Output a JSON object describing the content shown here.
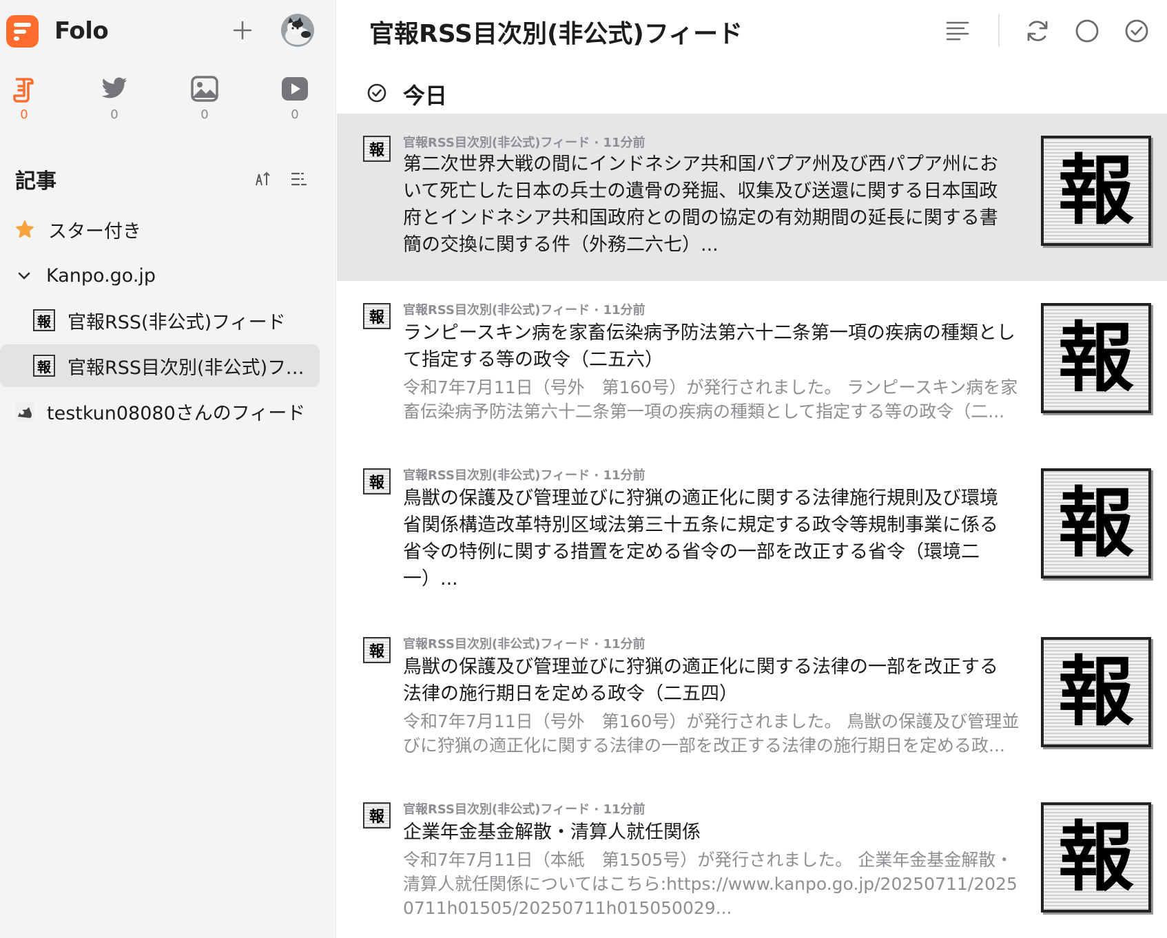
{
  "app": {
    "name": "Folo"
  },
  "sidebar": {
    "views": [
      {
        "icon": "article-icon",
        "count": "0",
        "active": true
      },
      {
        "icon": "twitter-icon",
        "count": "0"
      },
      {
        "icon": "picture-icon",
        "count": "0"
      },
      {
        "icon": "video-icon",
        "count": "0"
      }
    ],
    "section_title": "記事",
    "starred_label": "スター付き",
    "folder_label": "Kanpo.go.jp",
    "feeds": [
      {
        "label": "官報RSS(非公式)フィード",
        "icon_char": "報"
      },
      {
        "label": "官報RSS目次別(非公式)フィード",
        "icon_char": "報"
      }
    ],
    "other_feed_label": "testkun08080さんのフィード"
  },
  "main": {
    "feed_title": "官報RSS目次別(非公式)フィード",
    "day_label": "今日",
    "thumb_char": "報",
    "entries": [
      {
        "meta": "官報RSS目次別(非公式)フィード · 11分前",
        "title": "第二次世界大戦の間にインドネシア共和国パプア州及び西パプア州において死亡した日本の兵士の遺骨の発掘、収集及び送還に関する日本国政府とインドネシア共和国政府との間の協定の有効期間の延長に関する書簡の交換に関する件（外務二六七）...",
        "desc": ""
      },
      {
        "meta": "官報RSS目次別(非公式)フィード · 11分前",
        "title": "ランピースキン病を家畜伝染病予防法第六十二条第一項の疾病の種類として指定する等の政令（二五六）",
        "desc": "令和7年7月11日（号外　第160号）が発行されました。 ランピースキン病を家畜伝染病予防法第六十二条第一項の疾病の種類として指定する等の政令（二..."
      },
      {
        "meta": "官報RSS目次別(非公式)フィード · 11分前",
        "title": "鳥獣の保護及び管理並びに狩猟の適正化に関する法律施行規則及び環境省関係構造改革特別区域法第三十五条に規定する政令等規制事業に係る省令の特例に関する措置を定める省令の一部を改正する省令（環境二一）...",
        "desc": ""
      },
      {
        "meta": "官報RSS目次別(非公式)フィード · 11分前",
        "title": "鳥獣の保護及び管理並びに狩猟の適正化に関する法律の一部を改正する法律の施行期日を定める政令（二五四）",
        "desc": "令和7年7月11日（号外　第160号）が発行されました。 鳥獣の保護及び管理並びに狩猟の適正化に関する法律の一部を改正する法律の施行期日を定める政..."
      },
      {
        "meta": "官報RSS目次別(非公式)フィード · 11分前",
        "title": "企業年金基金解散・清算人就任関係",
        "desc": "令和7年7月11日（本紙　第1505号）が発行されました。 企業年金基金解散・清算人就任関係についてはこちら:https://www.kanpo.go.jp/20250711/20250711h01505/20250711h015050029..."
      }
    ]
  }
}
